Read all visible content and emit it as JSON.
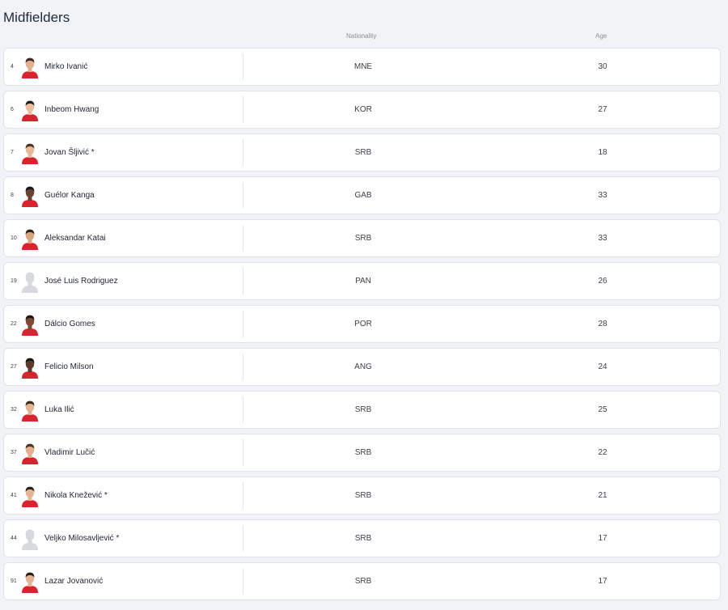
{
  "section": {
    "title": "Midfielders"
  },
  "columns": {
    "nationality": "Nationality",
    "age": "Age"
  },
  "colors": {
    "kit_red": "#d9232e",
    "placeholder_grey": "#d6d9de"
  },
  "players": [
    {
      "number": "4",
      "name": "Mirko Ivanić",
      "nationality": "MNE",
      "age": "30",
      "skin": "#e2b08f",
      "hair": "#3a2a20",
      "placeholder": false
    },
    {
      "number": "6",
      "name": "Inbeom Hwang",
      "nationality": "KOR",
      "age": "27",
      "skin": "#e8c09e",
      "hair": "#1c1c1c",
      "placeholder": false
    },
    {
      "number": "7",
      "name": "Jovan Šljivić *",
      "nationality": "SRB",
      "age": "18",
      "skin": "#e6b898",
      "hair": "#4a3524",
      "placeholder": false
    },
    {
      "number": "8",
      "name": "Guélor Kanga",
      "nationality": "GAB",
      "age": "33",
      "skin": "#6a4330",
      "hair": "#1a1a1a",
      "placeholder": false
    },
    {
      "number": "10",
      "name": "Aleksandar Katai",
      "nationality": "SRB",
      "age": "33",
      "skin": "#d9a582",
      "hair": "#2e2218",
      "placeholder": false
    },
    {
      "number": "19",
      "name": "José Luis Rodriguez",
      "nationality": "PAN",
      "age": "26",
      "skin": "#d6d9de",
      "hair": "#d6d9de",
      "placeholder": true
    },
    {
      "number": "22",
      "name": "Dálcio Gomes",
      "nationality": "POR",
      "age": "28",
      "skin": "#7a4a32",
      "hair": "#1e1610",
      "placeholder": false
    },
    {
      "number": "27",
      "name": "Felicio Milson",
      "nationality": "ANG",
      "age": "24",
      "skin": "#5e3a28",
      "hair": "#151515",
      "placeholder": false
    },
    {
      "number": "32",
      "name": "Luka Ilić",
      "nationality": "SRB",
      "age": "25",
      "skin": "#e3b493",
      "hair": "#3b2b1d",
      "placeholder": false
    },
    {
      "number": "37",
      "name": "Vladimir Lučić",
      "nationality": "SRB",
      "age": "22",
      "skin": "#e0b090",
      "hair": "#4b3626",
      "placeholder": false
    },
    {
      "number": "41",
      "name": "Nikola Knežević *",
      "nationality": "SRB",
      "age": "21",
      "skin": "#e5b696",
      "hair": "#2c2019",
      "placeholder": false
    },
    {
      "number": "44",
      "name": "Veljko Milosavljević *",
      "nationality": "SRB",
      "age": "17",
      "skin": "#d6d9de",
      "hair": "#d6d9de",
      "placeholder": true
    },
    {
      "number": "91",
      "name": "Lazar Jovanović",
      "nationality": "SRB",
      "age": "17",
      "skin": "#e4b595",
      "hair": "#2a1f17",
      "placeholder": false
    }
  ]
}
